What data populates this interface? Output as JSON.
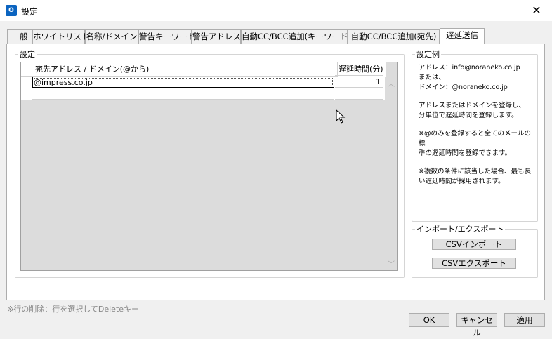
{
  "window": {
    "title": "設定",
    "app_icon_letter": "O"
  },
  "tabs": [
    {
      "label": "一般"
    },
    {
      "label": "ホワイトリスト"
    },
    {
      "label": "名称/ドメイン"
    },
    {
      "label": "警告キーワード"
    },
    {
      "label": "警告アドレス"
    },
    {
      "label": "自動CC/BCC追加(キーワード)"
    },
    {
      "label": "自動CC/BCC追加(宛先)"
    },
    {
      "label": "遅延送信",
      "active": true
    }
  ],
  "settings": {
    "legend": "設定",
    "columns": [
      "宛先アドレス / ドメイン(@から)",
      "遅延時間(分)"
    ],
    "rows": [
      {
        "address": "@impress.co.jp",
        "delay": "1"
      },
      {
        "address": "",
        "delay": ""
      }
    ]
  },
  "example": {
    "legend": "設定例",
    "paragraphs": [
      [
        "アドレス：info@noraneko.co.jp",
        "または、",
        "ドメイン：@noraneko.co.jp"
      ],
      [
        "アドレスまたはドメインを登録し、",
        "分単位で遅延時間を登録します。"
      ],
      [
        "※@のみを登録すると全てのメールの標",
        "準の遅延時間を登録できます。"
      ],
      [
        "※複数の条件に該当した場合、最も長",
        "い遅延時間が採用されます。"
      ]
    ]
  },
  "import_export": {
    "legend": "インポート/エクスポート",
    "import_label": "CSVインポート",
    "export_label": "CSVエクスポート"
  },
  "footer": {
    "note": "※行の削除：行を選択してDeleteキー",
    "ok_label": "OK",
    "cancel_label": "キャンセル",
    "apply_label": "適用"
  }
}
